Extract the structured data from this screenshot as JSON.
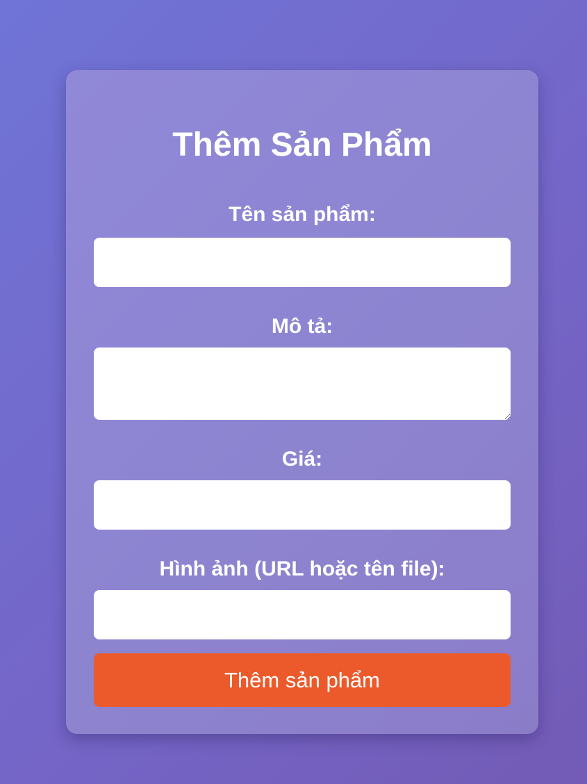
{
  "form": {
    "title": "Thêm Sản Phẩm",
    "fields": [
      {
        "label": "Tên sản phẩm:",
        "value": "",
        "placeholder": ""
      },
      {
        "label": "Mô tả:",
        "value": "",
        "placeholder": ""
      },
      {
        "label": "Giá:",
        "value": "",
        "placeholder": ""
      },
      {
        "label": "Hình ảnh (URL hoặc tên file):",
        "value": "",
        "placeholder": ""
      }
    ],
    "submit_label": "Thêm sản phẩm"
  },
  "colors": {
    "background_start": "#6f74d6",
    "background_end": "#735bb6",
    "card": "#8d84d0",
    "field_background": "#ffffff",
    "submit_button": "#ec5a2b",
    "text": "#ffffff"
  }
}
